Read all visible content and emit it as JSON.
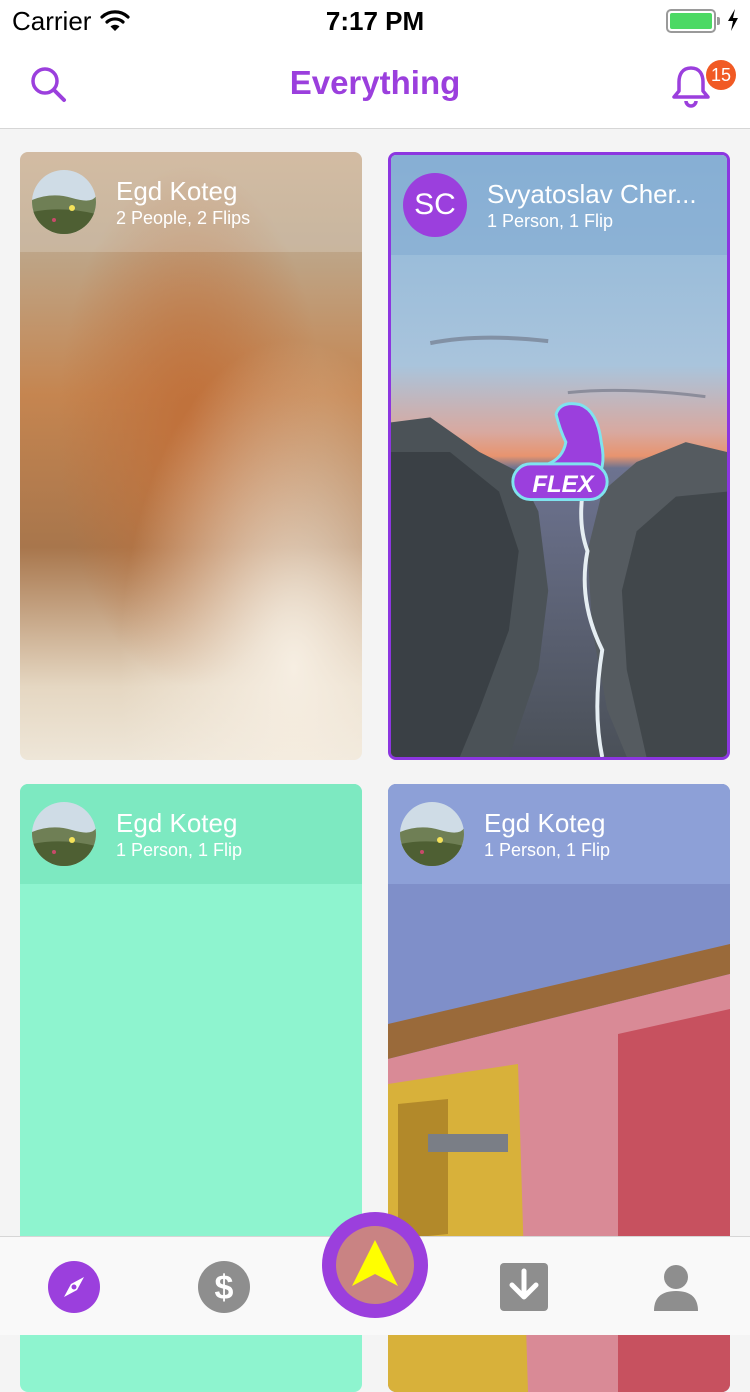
{
  "status_bar": {
    "carrier": "Carrier",
    "time": "7:17 PM"
  },
  "nav": {
    "title": "Everything",
    "notification_count": "15"
  },
  "cards": [
    {
      "name": "Egd Koteg",
      "subtitle": "2 People, 2 Flips"
    },
    {
      "name": "Svyatoslav Cher...",
      "subtitle": "1 Person, 1 Flip",
      "initials": "SC",
      "sticker": "FLEX"
    },
    {
      "name": "Egd Koteg",
      "subtitle": "1 Person, 1 Flip"
    },
    {
      "name": "Egd Koteg",
      "subtitle": "1 Person, 1 Flip"
    }
  ],
  "colors": {
    "accent": "#9b3fdd",
    "badge": "#f15a24",
    "mint": "#8ef4cf"
  },
  "tabs": [
    "compass-icon",
    "dollar-icon",
    "upload-arrow-icon",
    "download-icon",
    "profile-icon"
  ]
}
